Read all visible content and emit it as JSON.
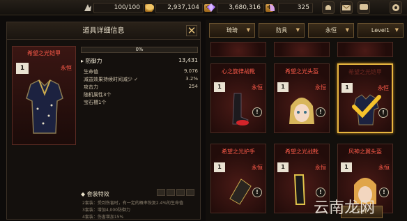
{
  "topbar": {
    "stamina": "100/100",
    "gold": "2,937,104",
    "gems": "3,680,316",
    "tickets": "325"
  },
  "detail_panel": {
    "title": "道具详细信息",
    "close_label": "✕",
    "item_name": "希望之光铠甲",
    "item_level": "1",
    "item_grade": "永恒",
    "progress_text": "0%",
    "progress_value": 0,
    "main_stat": {
      "label": "防御力",
      "value": "13,431"
    },
    "stats": [
      {
        "label": "生命值",
        "value": "9,076"
      },
      {
        "label": "减益效果持续时间减少 ✓",
        "value": "3.2%"
      },
      {
        "label": "攻击力",
        "value": "254"
      },
      {
        "label": "随机属性3个",
        "value": ""
      },
      {
        "label": "宝石槽1个",
        "value": ""
      }
    ],
    "set_title": "套装特效",
    "set_lines": [
      "2套装：受到伤害时，有一定的概率恢复2.4%的生命值",
      "3套装：增加4,000防御力",
      "4套装：伤害增加15%"
    ]
  },
  "filters": [
    {
      "label": "琦琦"
    },
    {
      "label": "防具"
    },
    {
      "label": "永恒"
    },
    {
      "label": "Level1"
    }
  ],
  "inventory": [
    {
      "name": "心之旋律战靴",
      "level": "1",
      "grade": "永恒",
      "icon": "boots-icon"
    },
    {
      "name": "希望之光头盔",
      "level": "1",
      "grade": "永恒",
      "icon": "helmet-girl-icon"
    },
    {
      "name": "希望之光铠甲",
      "level": "1",
      "grade": "永恒",
      "icon": "armor-icon"
    },
    {
      "name": "希望之光护手",
      "level": "1",
      "grade": "永恒",
      "icon": "gauntlet-icon"
    },
    {
      "name": "希望之光战靴",
      "level": "1",
      "grade": "永恒",
      "icon": "boots-icon"
    },
    {
      "name": "风神之翼头盔",
      "level": "1",
      "grade": "永恒",
      "icon": "helmet-boy-icon"
    }
  ],
  "set_button_label": "Set",
  "watermark": "云南龙网"
}
